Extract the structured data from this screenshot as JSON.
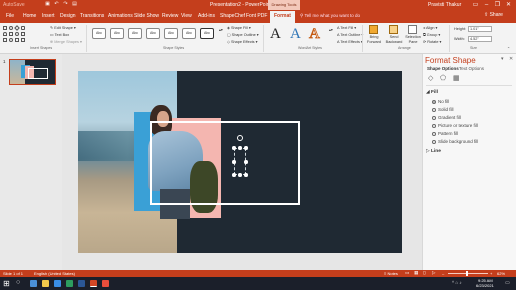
{
  "window": {
    "title": "Presentation2  -  PowerPoint",
    "contextual_group": "Drawing Tools",
    "user": "Pravisti Thakur",
    "quick_access": [
      "AutoSave",
      "save-icon",
      "undo-icon",
      "redo-icon",
      "present-icon"
    ]
  },
  "tabs": [
    {
      "label": "File"
    },
    {
      "label": "Home"
    },
    {
      "label": "Insert"
    },
    {
      "label": "Design"
    },
    {
      "label": "Transitions"
    },
    {
      "label": "Animations"
    },
    {
      "label": "Slide Show"
    },
    {
      "label": "Review"
    },
    {
      "label": "View"
    },
    {
      "label": "Add-ins"
    },
    {
      "label": "ShapeChef"
    },
    {
      "label": "Font PDF"
    },
    {
      "label": "Format"
    }
  ],
  "tell_me": "Tell me what you want to do",
  "share": "Share",
  "ribbon": {
    "insert_shapes": {
      "label": "Insert Shapes",
      "edit_shape": "Edit Shape",
      "text_box": "Text Box",
      "merge_shapes": "Merge Shapes"
    },
    "shape_styles": {
      "label": "Shape Styles",
      "preset": "Abc",
      "fill": "Shape Fill",
      "outline": "Shape Outline",
      "effects": "Shape Effects"
    },
    "wordart_styles": {
      "label": "WordArt Styles",
      "text_fill": "Text Fill",
      "text_outline": "Text Outline",
      "text_effects": "Text Effects"
    },
    "arrange": {
      "label": "Arrange",
      "bring_forward": "Bring Forward",
      "send_backward": "Send Backward",
      "selection_pane": "Selection Pane",
      "align": "Align",
      "group": "Group",
      "rotate": "Rotate"
    },
    "size": {
      "label": "Size",
      "height_label": "Height:",
      "height": "1.01\"",
      "width_label": "Width:",
      "width": "4.52\""
    }
  },
  "slides": {
    "current_number": "1"
  },
  "format_pane": {
    "title": "Format Shape",
    "tab_shape": "Shape Options",
    "tab_text": "Text Options",
    "section_fill": "Fill",
    "fill_options": [
      "No fill",
      "Solid fill",
      "Gradient fill",
      "Picture or texture fill",
      "Pattern fill",
      "Slide background fill"
    ],
    "selected_fill": 0,
    "section_line": "Line"
  },
  "status": {
    "slide_of": "Slide 1 of 1",
    "language": "English (United States)",
    "notes": "Notes",
    "zoom": "62%"
  },
  "taskbar": {
    "time": "9:25 AM",
    "date": "6/23/2021"
  },
  "colors": {
    "accent": "#c43e1c",
    "slide_bg": "#1f2933",
    "pink": "#f4b6b0",
    "blue": "#3aa0d6"
  }
}
